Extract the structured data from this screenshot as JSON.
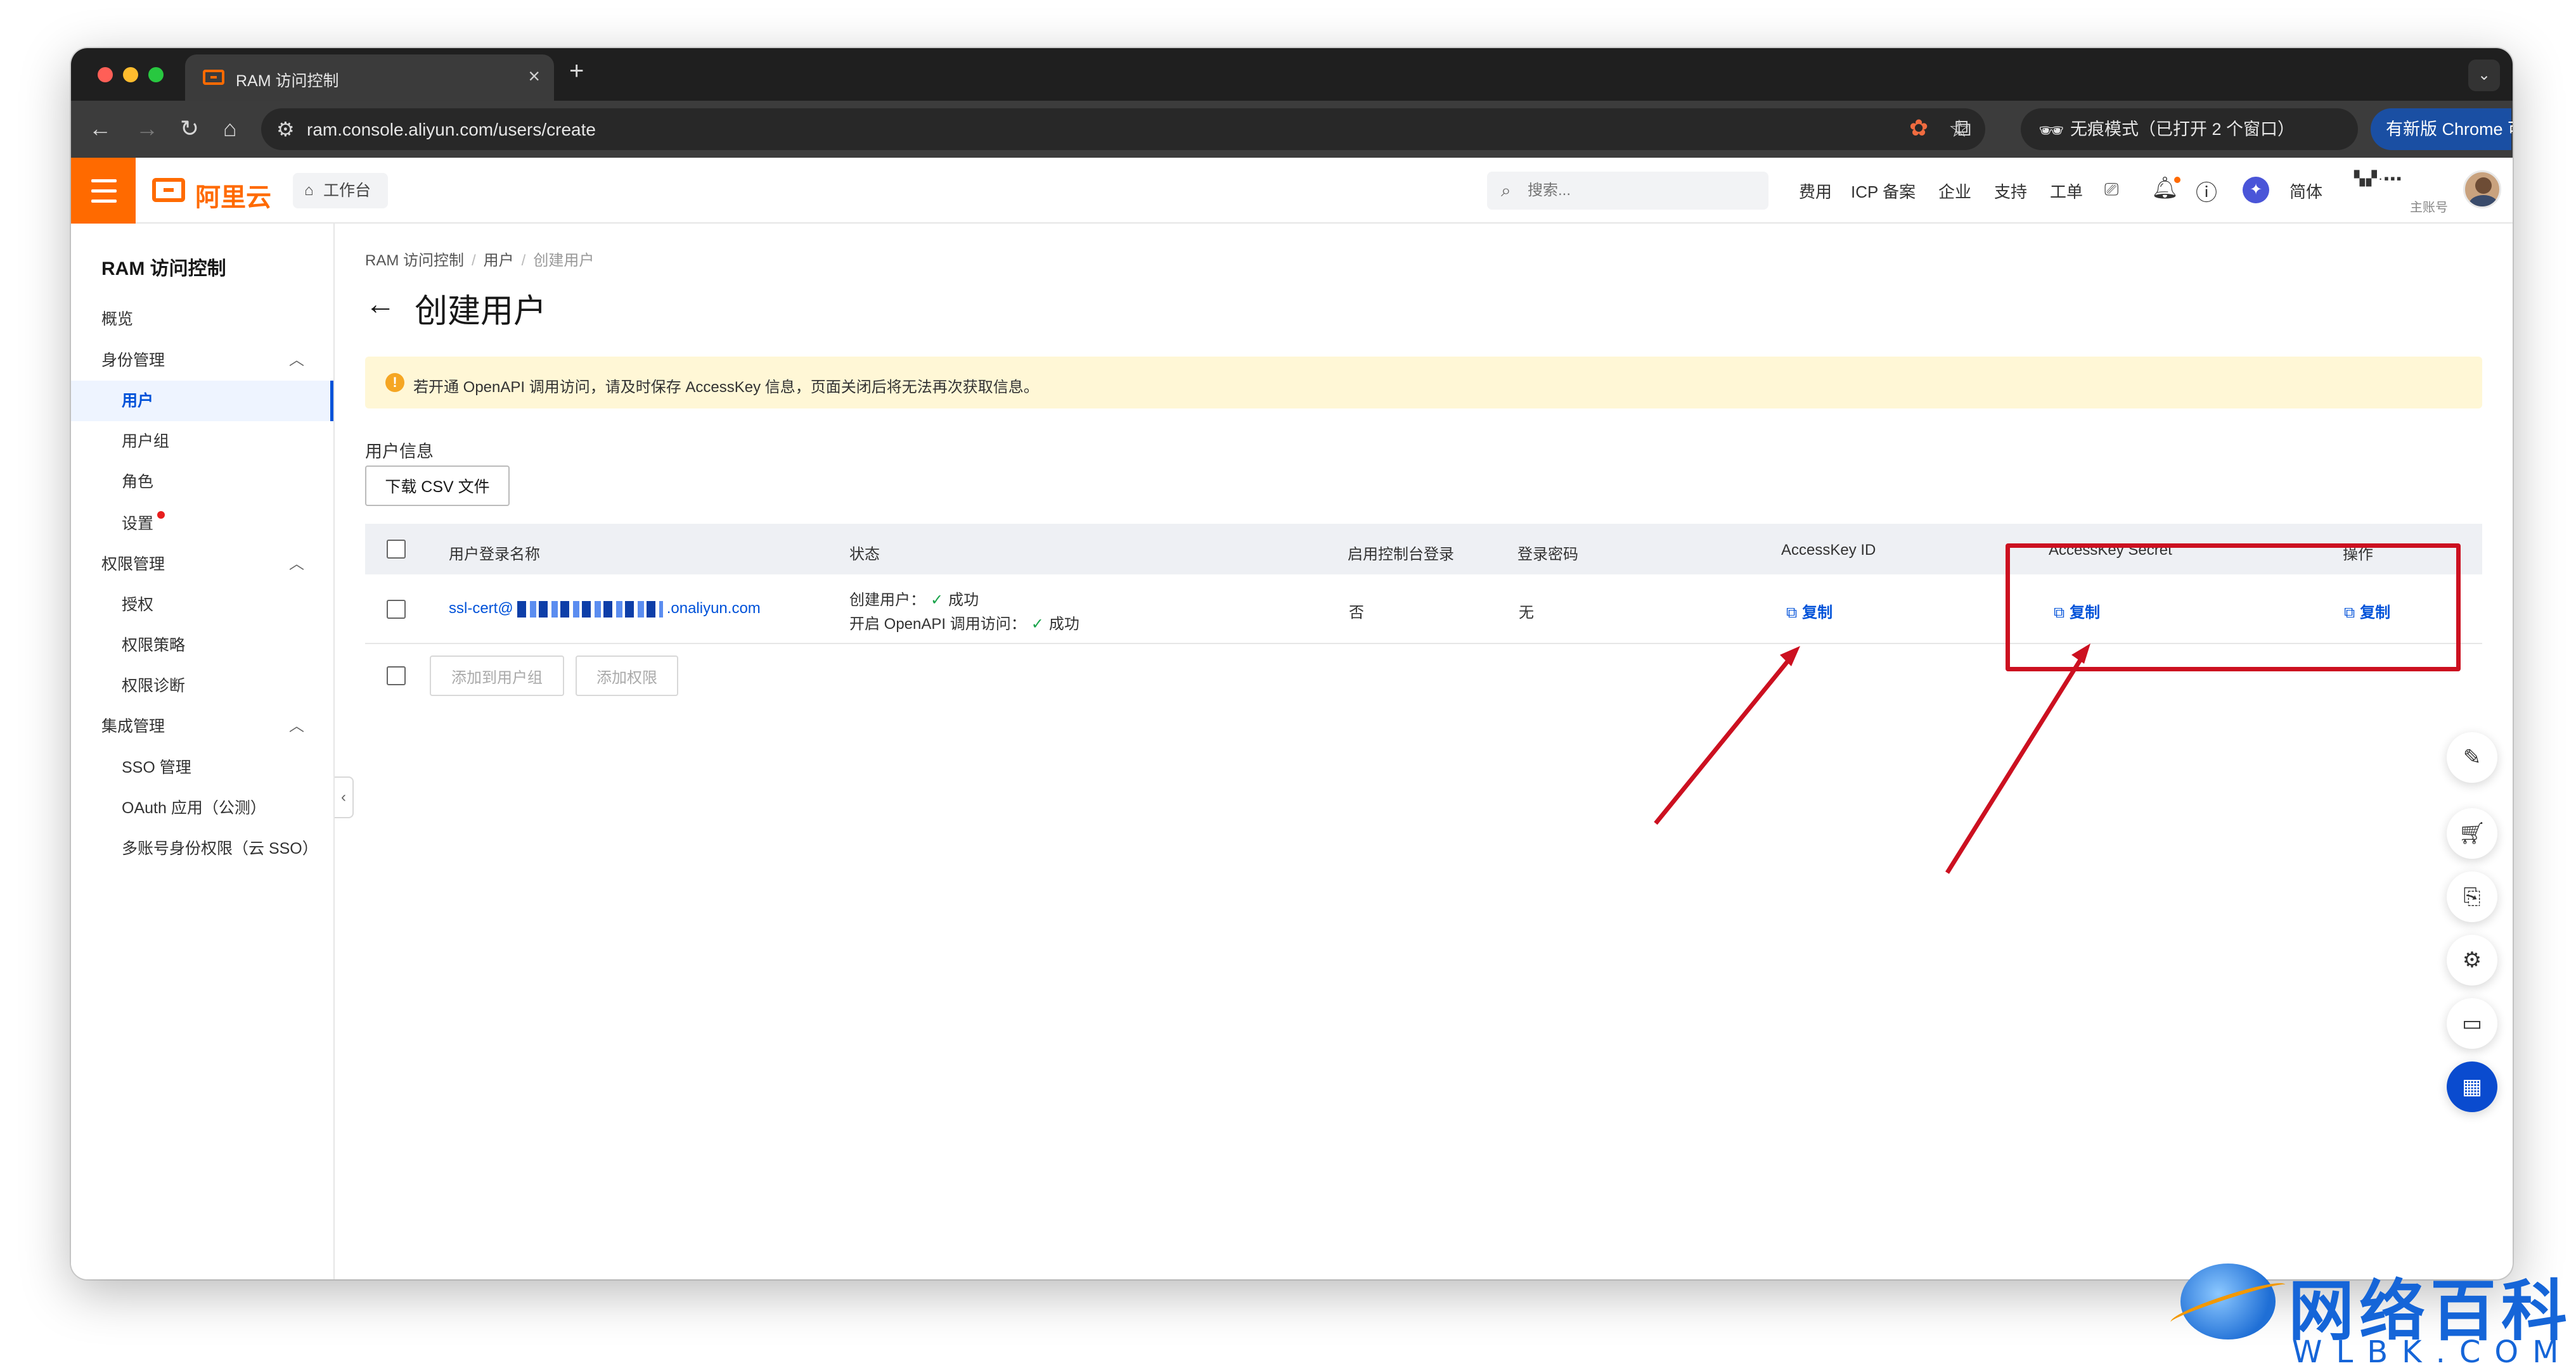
{
  "browser": {
    "tab_title": "RAM 访问控制",
    "tab_close": "×",
    "new_tab": "+",
    "url": "ram.console.aliyun.com/users/create",
    "incognito": "无痕模式（已打开 2 个窗口）",
    "update_button": "有新版 Chrome 可用"
  },
  "header": {
    "logo_text": "阿里云",
    "workbench": "工作台",
    "search_placeholder": "搜索...",
    "nav": [
      "费用",
      "ICP 备案",
      "企业",
      "支持",
      "工单"
    ],
    "language": "简体",
    "account_sub": "主账号"
  },
  "sidebar": {
    "title": "RAM 访问控制",
    "items": [
      {
        "label": "概览"
      },
      {
        "label": "身份管理"
      },
      {
        "label": "用户"
      },
      {
        "label": "用户组"
      },
      {
        "label": "角色"
      },
      {
        "label": "设置"
      },
      {
        "label": "权限管理"
      },
      {
        "label": "授权"
      },
      {
        "label": "权限策略"
      },
      {
        "label": "权限诊断"
      },
      {
        "label": "集成管理"
      },
      {
        "label": "SSO 管理"
      },
      {
        "label": "OAuth 应用（公测）"
      },
      {
        "label": "多账号身份权限（云 SSO）"
      }
    ]
  },
  "breadcrumb": [
    "RAM 访问控制",
    "用户",
    "创建用户"
  ],
  "page_title": "创建用户",
  "alert_text": "若开通 OpenAPI 调用访问，请及时保存 AccessKey 信息，页面关闭后将无法再次获取信息。",
  "section_label": "用户信息",
  "download_csv": "下载 CSV 文件",
  "table": {
    "headers": [
      "用户登录名称",
      "状态",
      "启用控制台登录",
      "登录密码",
      "AccessKey ID",
      "AccessKey Secret",
      "操作"
    ],
    "row": {
      "login_prefix": "ssl-cert@",
      "login_suffix": ".onaliyun.com",
      "status_create_label": "创建用户：",
      "status_create_value": "成功",
      "status_api_label": "开启 OpenAPI 调用访问：",
      "status_api_value": "成功",
      "console_login": "否",
      "password": "无",
      "copy_id": "复制",
      "copy_secret": "复制",
      "copy_action": "复制"
    }
  },
  "footer_buttons": {
    "add_group": "添加到用户组",
    "add_permission": "添加权限"
  },
  "watermark": {
    "title": "网络百科",
    "sub": "WLBK.COM"
  },
  "colors": {
    "brand": "#ff6a00",
    "link": "#0052d9",
    "annotation": "#cc1020",
    "alert_bg": "#fff7d6"
  }
}
